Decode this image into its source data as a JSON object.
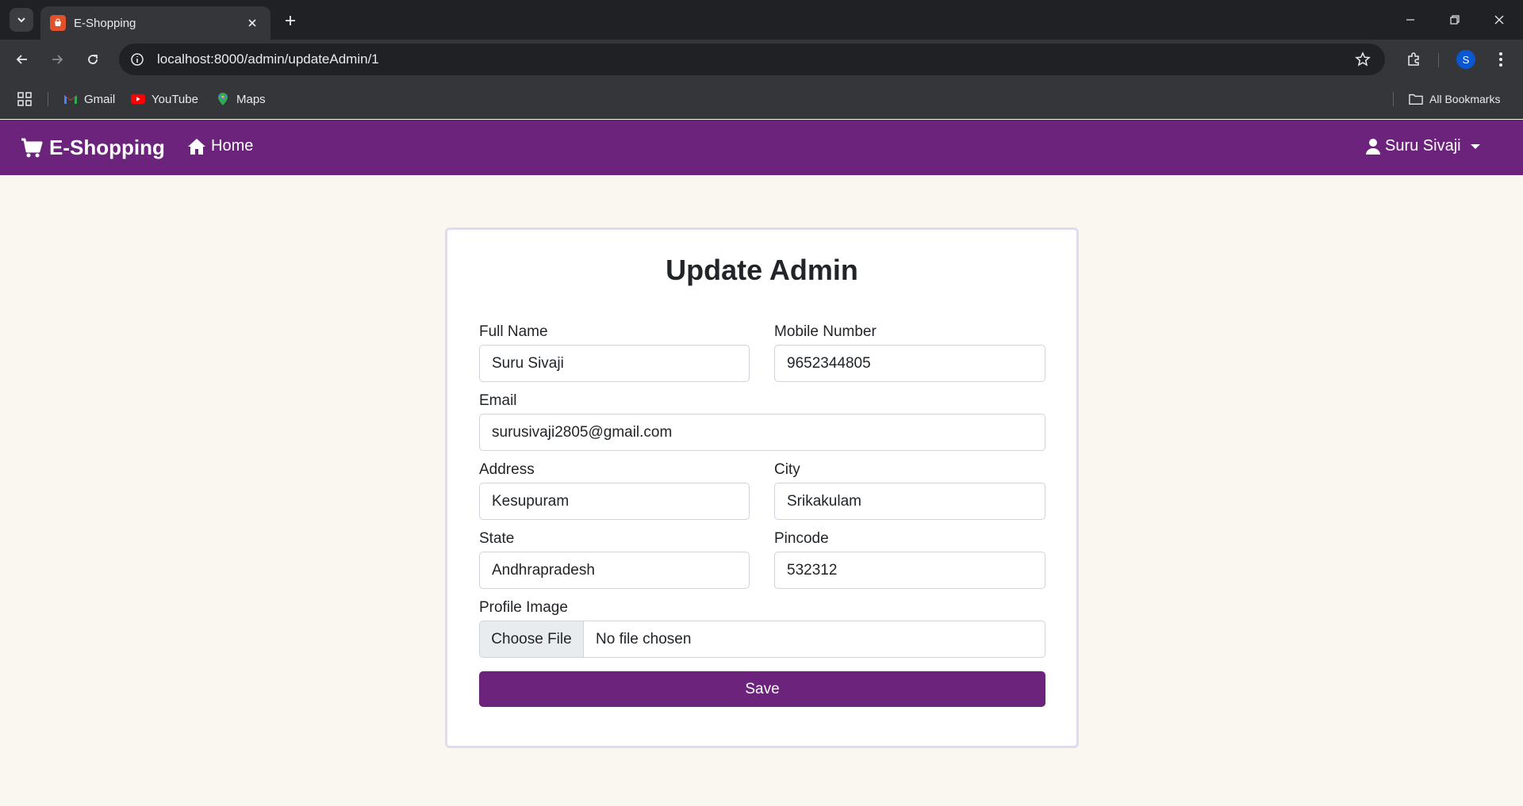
{
  "browser": {
    "tab_title": "E-Shopping",
    "url": "localhost:8000/admin/updateAdmin/1",
    "profile_initial": "S",
    "bookmarks": [
      {
        "label": "Gmail",
        "icon": "gmail-icon"
      },
      {
        "label": "YouTube",
        "icon": "youtube-icon"
      },
      {
        "label": "Maps",
        "icon": "maps-icon"
      }
    ],
    "all_bookmarks": "All Bookmarks"
  },
  "navbar": {
    "brand": "E-Shopping",
    "home": "Home",
    "user": "Suru Sivaji",
    "color": "#6c237c"
  },
  "form": {
    "title": "Update Admin",
    "full_name": {
      "label": "Full Name",
      "value": "Suru Sivaji"
    },
    "mobile": {
      "label": "Mobile Number",
      "value": "9652344805"
    },
    "email": {
      "label": "Email",
      "value": "surusivaji2805@gmail.com"
    },
    "address": {
      "label": "Address",
      "value": "Kesupuram"
    },
    "city": {
      "label": "City",
      "value": "Srikakulam"
    },
    "state": {
      "label": "State",
      "value": "Andhrapradesh"
    },
    "pincode": {
      "label": "Pincode",
      "value": "532312"
    },
    "profile_image": {
      "label": "Profile Image",
      "button": "Choose File",
      "status": "No file chosen"
    },
    "save_label": "Save"
  }
}
